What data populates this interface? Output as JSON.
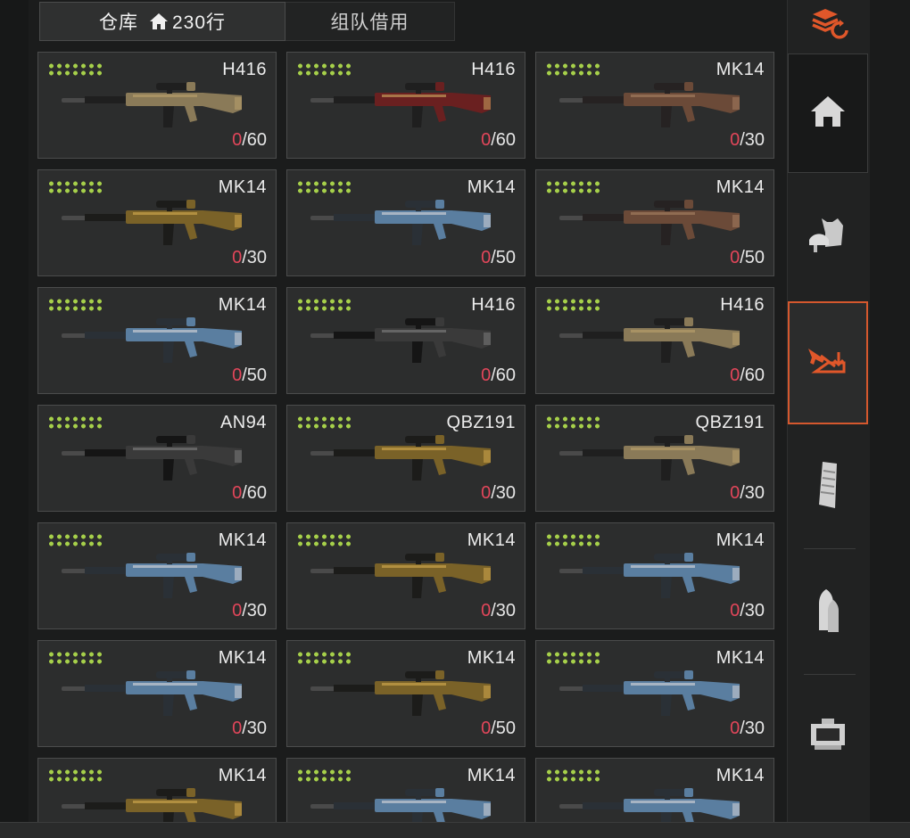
{
  "tabs": {
    "warehouse_label": "仓库",
    "warehouse_count": "230行",
    "team_borrow_label": "组队借用"
  },
  "cards": [
    {
      "name": "H416",
      "ammo_current": "0",
      "ammo_max": "/60",
      "style": "tan"
    },
    {
      "name": "H416",
      "ammo_current": "0",
      "ammo_max": "/60",
      "style": "red"
    },
    {
      "name": "MK14",
      "ammo_current": "0",
      "ammo_max": "/30",
      "style": "brown"
    },
    {
      "name": "MK14",
      "ammo_current": "0",
      "ammo_max": "/30",
      "style": "gold"
    },
    {
      "name": "MK14",
      "ammo_current": "0",
      "ammo_max": "/50",
      "style": "blue"
    },
    {
      "name": "MK14",
      "ammo_current": "0",
      "ammo_max": "/50",
      "style": "brown"
    },
    {
      "name": "MK14",
      "ammo_current": "0",
      "ammo_max": "/50",
      "style": "blue"
    },
    {
      "name": "H416",
      "ammo_current": "0",
      "ammo_max": "/60",
      "style": "dark"
    },
    {
      "name": "H416",
      "ammo_current": "0",
      "ammo_max": "/60",
      "style": "tan"
    },
    {
      "name": "AN94",
      "ammo_current": "0",
      "ammo_max": "/60",
      "style": "dark"
    },
    {
      "name": "QBZ191",
      "ammo_current": "0",
      "ammo_max": "/30",
      "style": "gold"
    },
    {
      "name": "QBZ191",
      "ammo_current": "0",
      "ammo_max": "/30",
      "style": "tan"
    },
    {
      "name": "MK14",
      "ammo_current": "0",
      "ammo_max": "/30",
      "style": "blue"
    },
    {
      "name": "MK14",
      "ammo_current": "0",
      "ammo_max": "/30",
      "style": "gold"
    },
    {
      "name": "MK14",
      "ammo_current": "0",
      "ammo_max": "/30",
      "style": "blue"
    },
    {
      "name": "MK14",
      "ammo_current": "0",
      "ammo_max": "/30",
      "style": "blue"
    },
    {
      "name": "MK14",
      "ammo_current": "0",
      "ammo_max": "/50",
      "style": "gold"
    },
    {
      "name": "MK14",
      "ammo_current": "0",
      "ammo_max": "/30",
      "style": "blue"
    },
    {
      "name": "MK14",
      "ammo_current": "",
      "ammo_max": "",
      "style": "gold"
    },
    {
      "name": "MK14",
      "ammo_current": "",
      "ammo_max": "",
      "style": "blue"
    },
    {
      "name": "MK14",
      "ammo_current": "",
      "ammo_max": "",
      "style": "blue"
    }
  ],
  "sidebar": {
    "items": [
      {
        "icon": "layers-refresh-icon"
      },
      {
        "icon": "home-icon"
      },
      {
        "icon": "helmet-armor-icon"
      },
      {
        "icon": "rifle-download-icon"
      },
      {
        "icon": "magazine-icon"
      },
      {
        "icon": "bullets-icon"
      },
      {
        "icon": "red-dot-sight-icon"
      }
    ]
  },
  "colors": {
    "accent": "#e0572a",
    "durability": "#a6d04a",
    "ammo_empty": "#e2465a"
  }
}
